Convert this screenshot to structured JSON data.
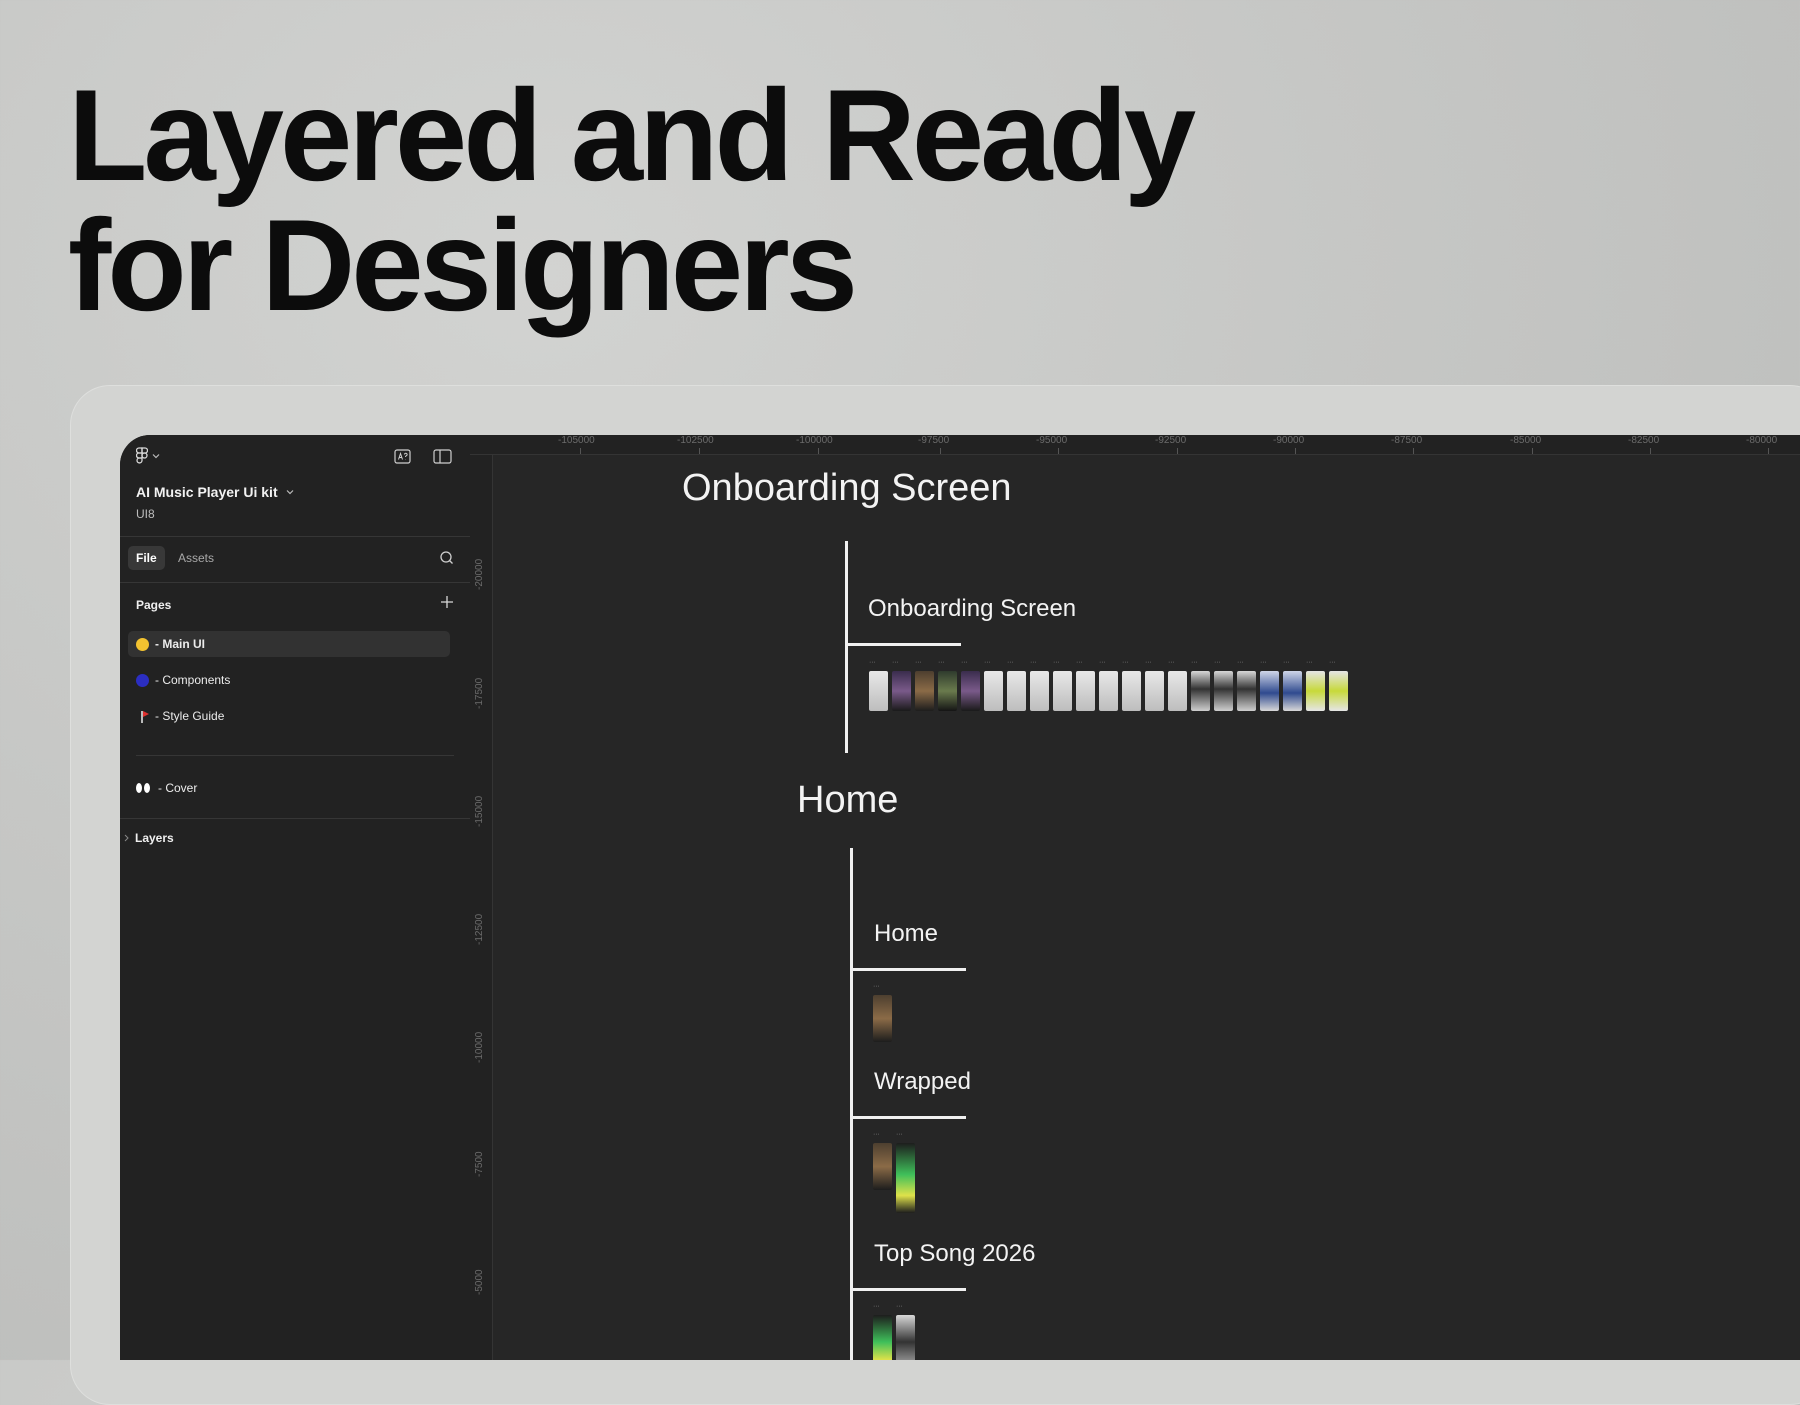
{
  "hero": {
    "headline_line1": "Layered and Ready",
    "headline_line2": "for Designers"
  },
  "sidebar": {
    "project_name": "AI Music Player Ui kit",
    "project_sub": "UI8",
    "tabs": {
      "file": "File",
      "assets": "Assets"
    },
    "pages_title": "Pages",
    "pages": [
      {
        "label": "- Main UI",
        "icon": "smiley-face-emoji"
      },
      {
        "label": "- Components",
        "icon": "blue-circle-emoji"
      },
      {
        "label": "- Style Guide",
        "icon": "golf-flag-emoji"
      },
      {
        "label": "-  Cover",
        "icon": "eyes-emoji"
      }
    ],
    "layers_title": "Layers"
  },
  "ruler": {
    "top": [
      "-105000",
      "-102500",
      "-100000",
      "-97500",
      "-95000",
      "-92500",
      "-90000",
      "-87500",
      "-85000",
      "-82500",
      "-80000"
    ],
    "left": [
      "-20000",
      "-17500",
      "-15000",
      "-12500",
      "-10000",
      "-7500",
      "-5000"
    ]
  },
  "canvas": {
    "section1_title": "Onboarding Screen",
    "section1_sub": "Onboarding Screen",
    "section2_title": "Home",
    "section2_home": "Home",
    "section2_wrapped": "Wrapped",
    "section2_topsong": "Top Song 2026"
  },
  "colors": {
    "background": "#c6c7c5",
    "headline": "#0c0c0c",
    "app_bg": "#262626",
    "sidebar_bg": "#222222",
    "canvas_text": "#f3f3f3"
  }
}
